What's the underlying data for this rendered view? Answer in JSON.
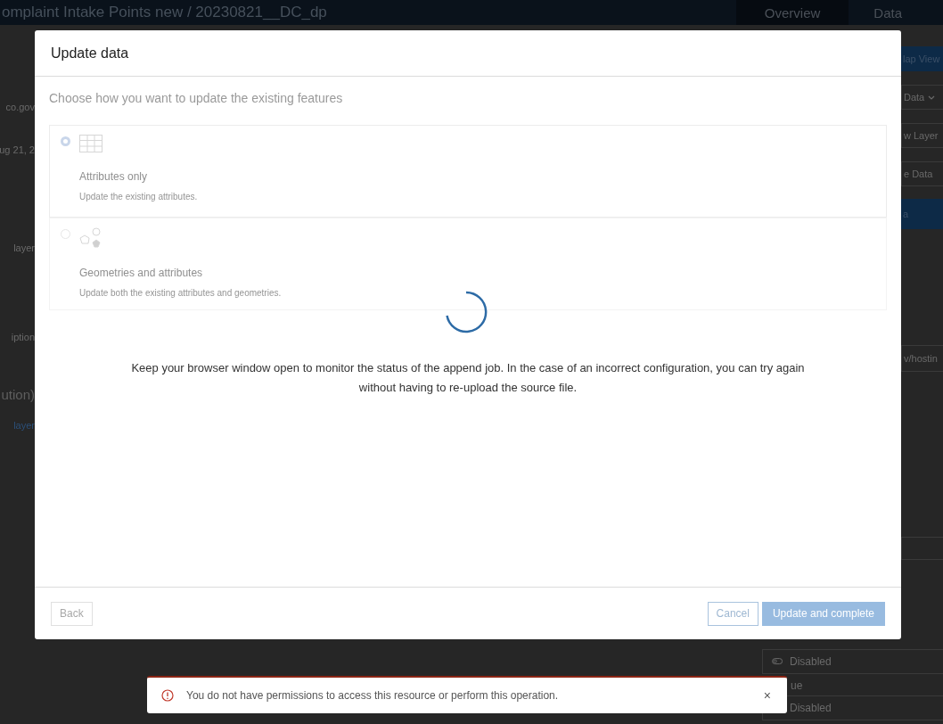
{
  "header": {
    "title": "omplaint Intake Points new / 20230821__DC_dp",
    "tabs": [
      {
        "label": "Overview",
        "selected": true
      },
      {
        "label": "Data",
        "selected": false
      }
    ]
  },
  "page_left": [
    {
      "kind": "text",
      "text": "co.gov"
    },
    {
      "kind": "text",
      "text": "ug 21, 2"
    },
    {
      "kind": "text",
      "text": "layer"
    },
    {
      "kind": "text",
      "text": "iption"
    },
    {
      "kind": "heading",
      "text": "ution)"
    },
    {
      "kind": "link",
      "text": "layer"
    }
  ],
  "page_right": [
    {
      "kind": "primary",
      "label": "lap View"
    },
    {
      "kind": "dropdown",
      "label": "Data"
    },
    {
      "kind": "outline",
      "label": "w Layer"
    },
    {
      "kind": "outline",
      "label": "e Data"
    },
    {
      "kind": "bar",
      "label": "a"
    },
    {
      "kind": "field",
      "label": "v/hostin"
    },
    {
      "kind": "blank"
    }
  ],
  "page_bottom": [
    {
      "kind": "toggle",
      "label": "Disabled"
    },
    {
      "kind": "text",
      "label": "ue"
    },
    {
      "kind": "toggle",
      "label": "Disabled"
    }
  ],
  "dialog": {
    "title": "Update data",
    "prompt": "Choose how you want to update the existing features",
    "options": [
      {
        "kind": "table",
        "title": "Attributes only",
        "description": "Update the existing attributes.",
        "selected": true
      },
      {
        "kind": "shapes",
        "title": "Geometries and attributes",
        "description": "Update both the existing attributes and geometries.",
        "selected": false
      }
    ],
    "loading": true,
    "message": "Keep your browser window open to monitor the status of the append job. In the case of an incorrect configuration, you can try again without having to re-upload the source file.",
    "buttons_left": [
      {
        "kind": "secondary",
        "label": "Back",
        "disabled": true
      }
    ],
    "buttons_right": [
      {
        "kind": "outline",
        "label": "Cancel",
        "disabled": true
      },
      {
        "kind": "primary",
        "label": "Update and complete",
        "disabled": true
      }
    ]
  },
  "toast": {
    "kind": "error",
    "message": "You do not have permissions to access this resource or perform this operation.",
    "close": "×"
  }
}
